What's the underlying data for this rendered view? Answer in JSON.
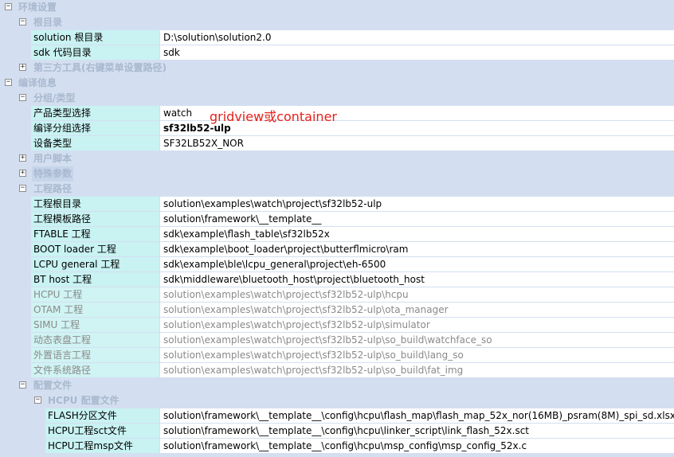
{
  "sections": {
    "env": "环境设置",
    "root_dir": "根目录",
    "third_party": "第三方工具(右键菜单设置路径)",
    "compile": "编译信息",
    "group": "分组/类型",
    "user_script": "用户脚本",
    "special": "特殊参数",
    "project_paths": "工程路径",
    "config_files": "配置文件",
    "hcpu_config": "HCPU 配置文件"
  },
  "rows": {
    "solution_root": {
      "label": "solution 根目录",
      "value": "D:\\solution\\solution2.0"
    },
    "sdk_dir": {
      "label": "sdk 代码目录",
      "value": "sdk"
    },
    "product_type": {
      "label": "产品类型选择",
      "value": "watch"
    },
    "compile_group": {
      "label": "编译分组选择",
      "value": "sf32lb52-ulp"
    },
    "device_type": {
      "label": "设备类型",
      "value": "SF32LB52X_NOR"
    },
    "project_root": {
      "label": "工程根目录",
      "value": "solution\\examples\\watch\\project\\sf32lb52-ulp"
    },
    "template_path": {
      "label": "工程模板路径",
      "value": "solution\\framework\\__template__"
    },
    "ftable": {
      "label": "FTABLE 工程",
      "value": "sdk\\example\\flash_table\\sf32lb52x"
    },
    "boot": {
      "label": "BOOT loader 工程",
      "value": "sdk\\example\\boot_loader\\project\\butterflmicro\\ram"
    },
    "lcpu": {
      "label": "LCPU general 工程",
      "value": "sdk\\example\\ble\\lcpu_general\\project\\eh-6500"
    },
    "bt": {
      "label": "BT host 工程",
      "value": "sdk\\middleware\\bluetooth_host\\project\\bluetooth_host"
    },
    "hcpu": {
      "label": "HCPU 工程",
      "value": "solution\\examples\\watch\\project\\sf32lb52-ulp\\hcpu"
    },
    "otam": {
      "label": "OTAM 工程",
      "value": "solution\\examples\\watch\\project\\sf32lb52-ulp\\ota_manager"
    },
    "simu": {
      "label": "SIMU 工程",
      "value": "solution\\examples\\watch\\project\\sf32lb52-ulp\\simulator"
    },
    "watchface": {
      "label": "动态表盘工程",
      "value": "solution\\examples\\watch\\project\\sf32lb52-ulp\\so_build\\watchface_so"
    },
    "lang": {
      "label": "外置语言工程",
      "value": "solution\\examples\\watch\\project\\sf32lb52-ulp\\so_build\\lang_so"
    },
    "fs_path": {
      "label": "文件系统路径",
      "value": "solution\\examples\\watch\\project\\sf32lb52-ulp\\so_build\\fat_img"
    },
    "flash_part": {
      "label": "FLASH分区文件",
      "value": "solution\\framework\\__template__\\config\\hcpu\\flash_map\\flash_map_52x_nor(16MB)_psram(8M)_spi_sd.xlsx"
    },
    "hcpu_sct": {
      "label": "HCPU工程sct文件",
      "value": "solution\\framework\\__template__\\config\\hcpu\\linker_script\\link_flash_52x.sct"
    },
    "hcpu_msp": {
      "label": "HCPU工程msp文件",
      "value": "solution\\framework\\__template__\\config\\hcpu\\msp_config\\msp_config_52x.c"
    }
  },
  "annotation": "gridview或container",
  "icons": {
    "expanded": "minus-box-icon",
    "collapsed": "plus-box-icon"
  },
  "colors": {
    "background": "#d3dff0",
    "name_cell": "#c9f2f2",
    "category_text": "#a9b8cf",
    "note": "#e8201a"
  }
}
